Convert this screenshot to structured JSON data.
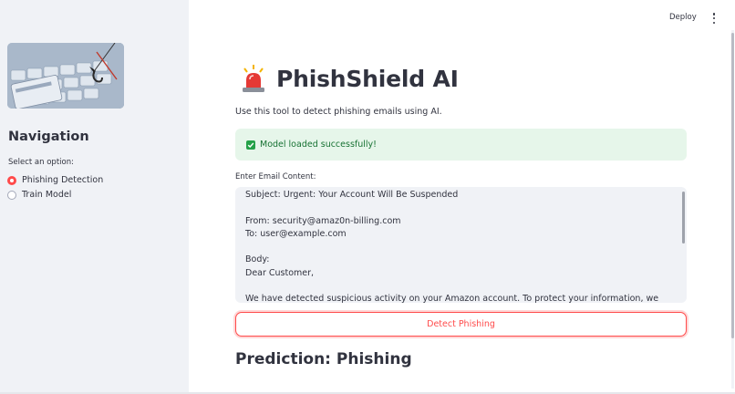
{
  "sidebar": {
    "navigation_title": "Navigation",
    "select_label": "Select an option:",
    "options": [
      {
        "label": "Phishing Detection",
        "selected": true
      },
      {
        "label": "Train Model",
        "selected": false
      }
    ]
  },
  "header": {
    "deploy_label": "Deploy"
  },
  "main": {
    "title": "PhishShield AI",
    "description": "Use this tool to detect phishing emails using AI.",
    "status_message": "Model loaded successfully!",
    "email_label": "Enter Email Content:",
    "email_content": "Subject: Urgent: Your Account Will Be Suspended\n\nFrom: security@amaz0n-billing.com\nTo: user@example.com\n\nBody:\nDear Customer,\n\nWe have detected suspicious activity on your Amazon account. To protect your information, we have",
    "detect_button_label": "Detect Phishing",
    "prediction_text": "Prediction: Phishing"
  },
  "colors": {
    "accent": "#ff4b4b",
    "success_bg": "#e6f6ea",
    "success_text": "#177233",
    "sidebar_bg": "#f0f2f6"
  },
  "icons": [
    "siren-icon",
    "check-icon",
    "more-vert-icon"
  ]
}
